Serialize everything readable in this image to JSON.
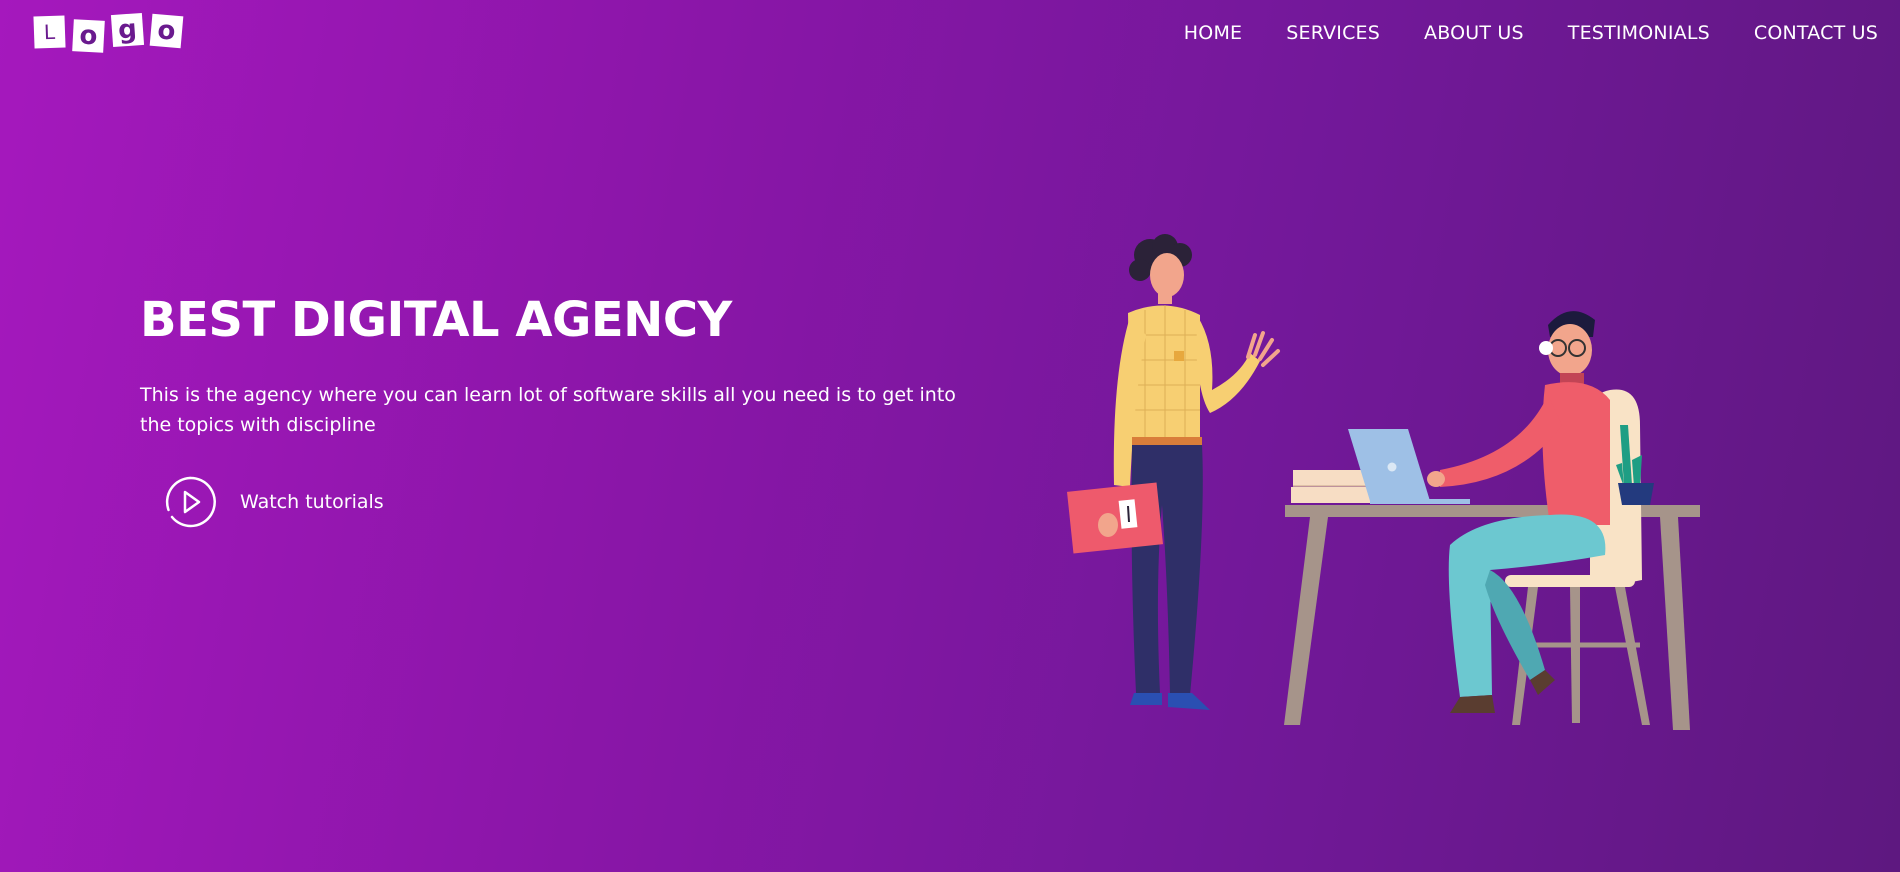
{
  "logo": {
    "letters": [
      "L",
      "o",
      "g",
      "o"
    ]
  },
  "nav": {
    "items": [
      "HOME",
      "SERVICES",
      "ABOUT US",
      "TESTIMONIALS",
      "CONTACT US"
    ]
  },
  "hero": {
    "title": "BEST DIGITAL AGENCY",
    "description": "This is the agency where you can learn lot of software skills all you need is to get into the topics with discipline",
    "cta_label": "Watch tutorials",
    "cta_icon": "play-circle-icon"
  },
  "colors": {
    "gradient_start": "#a518bd",
    "gradient_end": "#5e1880",
    "text": "#ffffff"
  }
}
